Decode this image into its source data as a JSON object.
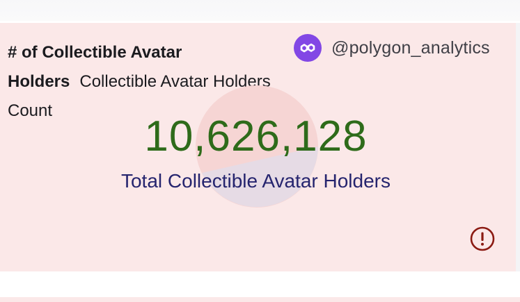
{
  "header": {
    "title_bold": "# of Collectible Avatar Holders",
    "title_sub": "Collectible Avatar Holders Count"
  },
  "brand": {
    "handle": "@polygon_analytics",
    "logo_icon": "polygon-logo-icon",
    "logo_color": "#8247e5"
  },
  "metric": {
    "value": "10,626,128",
    "caption": "Total Collectible Avatar Holders",
    "value_color": "#2e6b1a",
    "caption_color": "#25246e"
  },
  "status": {
    "icon": "alert-icon",
    "color": "#8b1a12"
  },
  "colors": {
    "card_background": "#fbe8e8"
  }
}
